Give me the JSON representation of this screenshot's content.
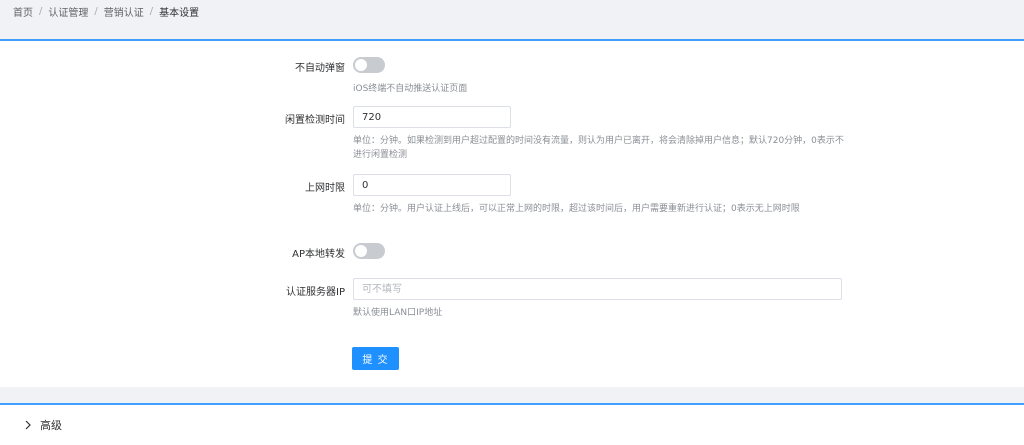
{
  "breadcrumb": {
    "items": [
      "首页",
      "认证管理",
      "营销认证",
      "基本设置"
    ],
    "separator": "/"
  },
  "form": {
    "no_popup": {
      "label": "不自动弹窗",
      "enabled": false,
      "help": "iOS终端不自动推送认证页面"
    },
    "idle_time": {
      "label": "闲置检测时间",
      "value": "720",
      "help": "单位：分钟。如果检测到用户超过配置的时间没有流量，则认为用户已离开，将会清除掉用户信息；默认720分钟，0表示不进行闲置检测"
    },
    "online_limit": {
      "label": "上网时限",
      "value": "0",
      "help": "单位：分钟。用户认证上线后，可以正常上网的时限，超过该时间后，用户需要重新进行认证；0表示无上网时限"
    },
    "ap_forward": {
      "label": "AP本地转发",
      "enabled": false
    },
    "auth_server_ip": {
      "label": "认证服务器IP",
      "value": "",
      "placeholder": "可不填写",
      "help": "默认使用LAN口IP地址"
    },
    "submit_label": "提 交"
  },
  "advanced": {
    "label": "高级",
    "expanded": false,
    "icon": "chevron-right-icon"
  },
  "colors": {
    "accent": "#409eff",
    "button": "#1e90ff",
    "switch_off": "#c8cbd0"
  }
}
